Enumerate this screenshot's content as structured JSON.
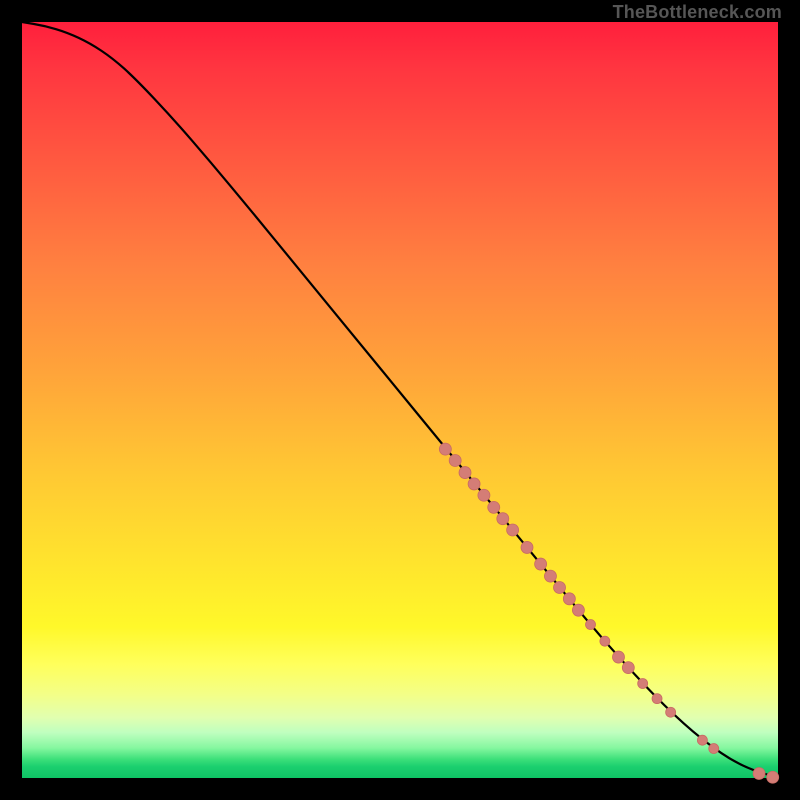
{
  "attribution": "TheBottleneck.com",
  "colors": {
    "curve": "#000000",
    "marker_fill": "#d47d76",
    "marker_stroke": "#c86b63",
    "gradient_top": "#ff1f3c",
    "gradient_bottom": "#0fc465",
    "page_bg": "#000000"
  },
  "chart_data": {
    "type": "line",
    "title": "",
    "xlabel": "",
    "ylabel": "",
    "xlim": [
      0,
      100
    ],
    "ylim": [
      0,
      100
    ],
    "grid": false,
    "legend": false,
    "curve": [
      {
        "x": 0,
        "y": 100
      },
      {
        "x": 3,
        "y": 99.5
      },
      {
        "x": 6,
        "y": 98.6
      },
      {
        "x": 9,
        "y": 97.2
      },
      {
        "x": 12,
        "y": 95.2
      },
      {
        "x": 15,
        "y": 92.5
      },
      {
        "x": 20,
        "y": 87.2
      },
      {
        "x": 25,
        "y": 81.4
      },
      {
        "x": 30,
        "y": 75.4
      },
      {
        "x": 35,
        "y": 69.3
      },
      {
        "x": 40,
        "y": 63.2
      },
      {
        "x": 45,
        "y": 57.1
      },
      {
        "x": 50,
        "y": 51.0
      },
      {
        "x": 55,
        "y": 44.9
      },
      {
        "x": 60,
        "y": 38.8
      },
      {
        "x": 65,
        "y": 32.7
      },
      {
        "x": 70,
        "y": 26.6
      },
      {
        "x": 75,
        "y": 20.5
      },
      {
        "x": 80,
        "y": 14.8
      },
      {
        "x": 85,
        "y": 9.5
      },
      {
        "x": 90,
        "y": 5.0
      },
      {
        "x": 95,
        "y": 1.6
      },
      {
        "x": 100,
        "y": 0
      }
    ],
    "markers": [
      {
        "x": 56.0,
        "y": 43.5,
        "r": 6
      },
      {
        "x": 57.3,
        "y": 42.0,
        "r": 6
      },
      {
        "x": 58.6,
        "y": 40.4,
        "r": 6
      },
      {
        "x": 59.8,
        "y": 38.9,
        "r": 6
      },
      {
        "x": 61.1,
        "y": 37.4,
        "r": 6
      },
      {
        "x": 62.4,
        "y": 35.8,
        "r": 6
      },
      {
        "x": 63.6,
        "y": 34.3,
        "r": 6
      },
      {
        "x": 64.9,
        "y": 32.8,
        "r": 6
      },
      {
        "x": 66.8,
        "y": 30.5,
        "r": 6
      },
      {
        "x": 68.6,
        "y": 28.3,
        "r": 6
      },
      {
        "x": 69.9,
        "y": 26.7,
        "r": 6
      },
      {
        "x": 71.1,
        "y": 25.2,
        "r": 6
      },
      {
        "x": 72.4,
        "y": 23.7,
        "r": 6
      },
      {
        "x": 73.6,
        "y": 22.2,
        "r": 6
      },
      {
        "x": 75.2,
        "y": 20.3,
        "r": 5
      },
      {
        "x": 77.1,
        "y": 18.1,
        "r": 5
      },
      {
        "x": 78.9,
        "y": 16.0,
        "r": 6
      },
      {
        "x": 80.2,
        "y": 14.6,
        "r": 6
      },
      {
        "x": 82.1,
        "y": 12.5,
        "r": 5
      },
      {
        "x": 84.0,
        "y": 10.5,
        "r": 5
      },
      {
        "x": 85.8,
        "y": 8.7,
        "r": 5
      },
      {
        "x": 90.0,
        "y": 5.0,
        "r": 5
      },
      {
        "x": 91.5,
        "y": 3.9,
        "r": 5
      },
      {
        "x": 97.5,
        "y": 0.6,
        "r": 6
      },
      {
        "x": 99.3,
        "y": 0.1,
        "r": 6
      }
    ]
  }
}
